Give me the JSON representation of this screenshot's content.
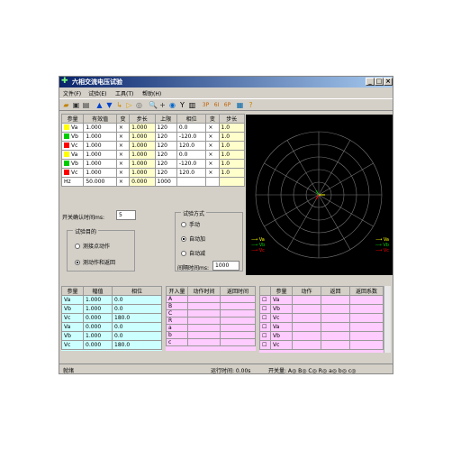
{
  "window": {
    "title": "六相交流电压试验"
  },
  "menu": [
    "文件(F)",
    "试验(E)",
    "工具(T)",
    "帮助(H)"
  ],
  "toolbar_icons": [
    "open-icon",
    "save-icon",
    "print-icon",
    "up-icon",
    "down-icon",
    "step-icon",
    "play-icon",
    "stop-icon",
    "zoom-icon",
    "plus-icon",
    "target-icon",
    "y-icon",
    "bars-icon",
    "3p-icon",
    "6i-icon",
    "6p-icon",
    "screen-icon",
    "help-icon"
  ],
  "params_table": {
    "headers": [
      "参量",
      "有效值",
      "变",
      "步长",
      "上限",
      "相位",
      "变",
      "步长"
    ],
    "rows": [
      {
        "name": "Va",
        "color": "#ffff00",
        "value": "1.000",
        "var1": "×",
        "step1": "1.000",
        "limit": "120",
        "phase": "0.0",
        "var2": "×",
        "step2": "1.0"
      },
      {
        "name": "Vb",
        "color": "#00cc00",
        "value": "1.000",
        "var1": "×",
        "step1": "1.000",
        "limit": "120",
        "phase": "-120.0",
        "var2": "×",
        "step2": "1.0"
      },
      {
        "name": "Vc",
        "color": "#ff0000",
        "value": "1.000",
        "var1": "×",
        "step1": "1.000",
        "limit": "120",
        "phase": "120.0",
        "var2": "×",
        "step2": "1.0"
      },
      {
        "name": "Va",
        "color": "#ffff00",
        "value": "1.000",
        "var1": "×",
        "step1": "1.000",
        "limit": "120",
        "phase": "0.0",
        "var2": "×",
        "step2": "1.0"
      },
      {
        "name": "Vb",
        "color": "#00cc00",
        "value": "1.000",
        "var1": "×",
        "step1": "1.000",
        "limit": "120",
        "phase": "-120.0",
        "var2": "×",
        "step2": "1.0"
      },
      {
        "name": "Vc",
        "color": "#ff0000",
        "value": "1.000",
        "var1": "×",
        "step1": "1.000",
        "limit": "120",
        "phase": "120.0",
        "var2": "×",
        "step2": "1.0"
      },
      {
        "name": "Hz",
        "color": "",
        "value": "50.000",
        "var1": "×",
        "step1": "0.000",
        "limit": "1000",
        "phase": "",
        "var2": "",
        "step2": ""
      }
    ]
  },
  "switch_confirm": {
    "label": "开关确认时间ms:",
    "value": "5"
  },
  "test_purpose": {
    "title": "试验目的",
    "options": [
      "测接点动作",
      "测动作和返回"
    ],
    "selected": 1
  },
  "test_mode": {
    "title": "试验方式",
    "options": [
      "手动",
      "自动加",
      "自动减"
    ],
    "selected": 1,
    "interval_label": "间隔时间ms:",
    "interval_value": "1000"
  },
  "scope_legend": {
    "left": [
      "Va",
      "Vb",
      "Vc"
    ],
    "right": [
      "Va",
      "Vb",
      "Vc"
    ]
  },
  "measure_table": {
    "headers": [
      "参量",
      "幅值",
      "相位"
    ],
    "rows": [
      [
        "Va",
        "1.000",
        "0.0"
      ],
      [
        "Vb",
        "1.000",
        "0.0"
      ],
      [
        "Vc",
        "0.000",
        "180.0"
      ],
      [
        "Va",
        "0.000",
        "0.0"
      ],
      [
        "Vb",
        "1.000",
        "0.0"
      ],
      [
        "Vc",
        "0.000",
        "180.0"
      ]
    ]
  },
  "switch_table": {
    "headers": [
      "开入量",
      "动作时间",
      "返回时间"
    ],
    "rows": [
      "A",
      "B",
      "C",
      "R",
      "a",
      "b",
      "c"
    ]
  },
  "result_table": {
    "headers": [
      "参量",
      "动作",
      "返回",
      "返回系数"
    ],
    "rows": [
      "Va",
      "Vb",
      "Vc",
      "Va",
      "Vb",
      "Vc"
    ]
  },
  "status": {
    "left": "就绪",
    "runtime": "运行时间: 0.00s",
    "switches": "开关量: A◎ B◎ C◎ R◎ a◎ b◎ c◎"
  },
  "colors": {
    "va": "#ffff00",
    "vb": "#00cc00",
    "vc": "#ff0000",
    "grid_bg": "#ffccff"
  }
}
